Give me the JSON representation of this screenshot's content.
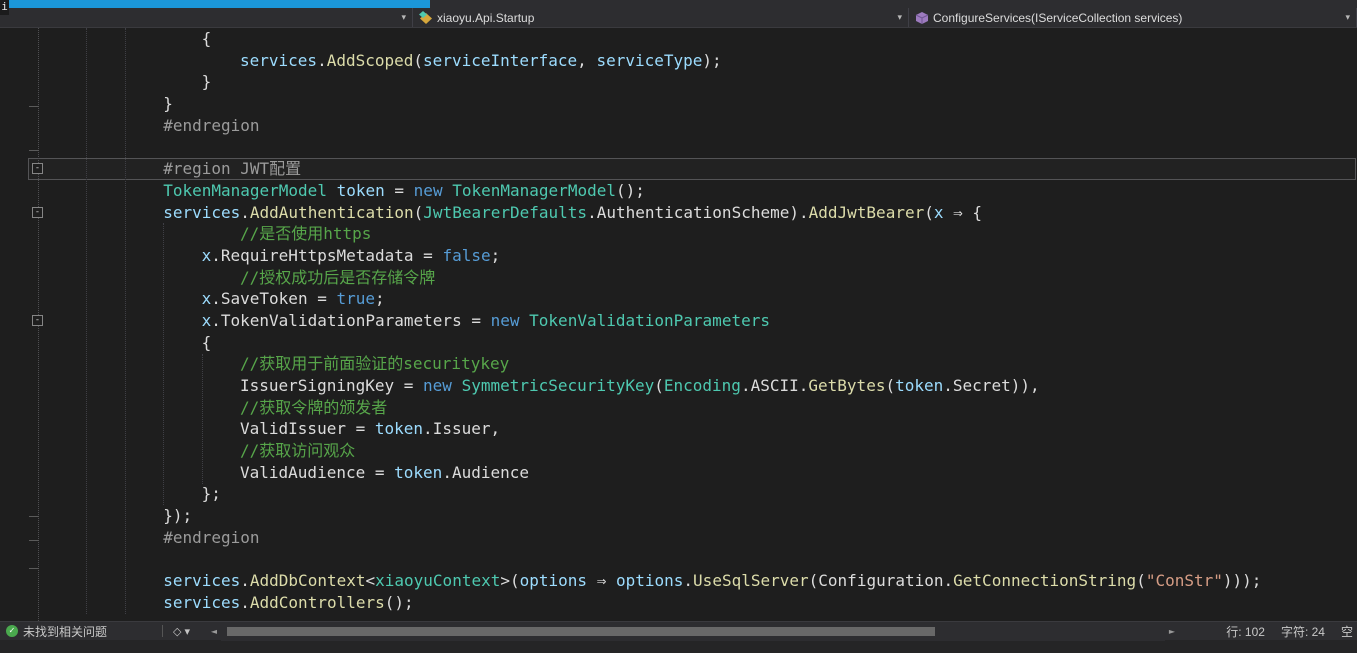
{
  "window": {
    "overlay_text": "i"
  },
  "nav": {
    "project_dropdown": {
      "value": ""
    },
    "type_dropdown": {
      "value": "xiaoyu.Api.Startup"
    },
    "member_dropdown": {
      "value": "ConfigureServices(IServiceCollection services)"
    }
  },
  "editor": {
    "current_line": 7,
    "fold_lines": [
      7,
      9,
      14
    ],
    "margin_ticks": [
      78,
      122,
      488,
      512,
      540
    ],
    "indent_guides": [
      {
        "col": 4,
        "from": 0,
        "to": 27
      },
      {
        "col": 8,
        "from": 0,
        "to": 27
      },
      {
        "col": 12,
        "from": 9,
        "to": 22
      },
      {
        "col": 16,
        "from": 15,
        "to": 21
      }
    ],
    "token_colors": {
      "p": "#dcdcdc",
      "kw": "#569cd6",
      "ty": "#4ec9b0",
      "lo": "#9cdcfe",
      "m": "#dcdcaa",
      "c": "#57a64a",
      "s": "#d69d85",
      "pp": "#9b9b9b"
    },
    "lines": [
      {
        "indent": 16,
        "tokens": [
          [
            "p",
            "{"
          ]
        ]
      },
      {
        "indent": 20,
        "tokens": [
          [
            "lo",
            "services"
          ],
          [
            "p",
            "."
          ],
          [
            "m",
            "AddScoped"
          ],
          [
            "p",
            "("
          ],
          [
            "lo",
            "serviceInterface"
          ],
          [
            "p",
            ", "
          ],
          [
            "lo",
            "serviceType"
          ],
          [
            "p",
            ");"
          ]
        ]
      },
      {
        "indent": 16,
        "tokens": [
          [
            "p",
            "}"
          ]
        ]
      },
      {
        "indent": 12,
        "tokens": [
          [
            "p",
            "}"
          ]
        ]
      },
      {
        "indent": 12,
        "tokens": [
          [
            "pp",
            "#endregion"
          ]
        ]
      },
      {
        "indent": 0,
        "tokens": []
      },
      {
        "indent": 12,
        "tokens": [
          [
            "pp",
            "#region JWT配置"
          ]
        ]
      },
      {
        "indent": 12,
        "tokens": [
          [
            "ty",
            "TokenManagerModel"
          ],
          [
            "p",
            " "
          ],
          [
            "lo",
            "token"
          ],
          [
            "p",
            " = "
          ],
          [
            "kw",
            "new"
          ],
          [
            "p",
            " "
          ],
          [
            "ty",
            "TokenManagerModel"
          ],
          [
            "p",
            "();"
          ]
        ]
      },
      {
        "indent": 12,
        "tokens": [
          [
            "lo",
            "services"
          ],
          [
            "p",
            "."
          ],
          [
            "m",
            "AddAuthentication"
          ],
          [
            "p",
            "("
          ],
          [
            "ty",
            "JwtBearerDefaults"
          ],
          [
            "p",
            "."
          ],
          [
            "p",
            "AuthenticationScheme"
          ],
          [
            "p",
            ")."
          ],
          [
            "m",
            "AddJwtBearer"
          ],
          [
            "p",
            "("
          ],
          [
            "lo",
            "x"
          ],
          [
            "p",
            " ⇒ {"
          ]
        ]
      },
      {
        "indent": 20,
        "tokens": [
          [
            "c",
            "//是否使用https"
          ]
        ]
      },
      {
        "indent": 16,
        "tokens": [
          [
            "lo",
            "x"
          ],
          [
            "p",
            "."
          ],
          [
            "p",
            "RequireHttpsMetadata"
          ],
          [
            "p",
            " = "
          ],
          [
            "kw",
            "false"
          ],
          [
            "p",
            ";"
          ]
        ]
      },
      {
        "indent": 20,
        "tokens": [
          [
            "c",
            "//授权成功后是否存储令牌"
          ]
        ]
      },
      {
        "indent": 16,
        "tokens": [
          [
            "lo",
            "x"
          ],
          [
            "p",
            "."
          ],
          [
            "p",
            "SaveToken"
          ],
          [
            "p",
            " = "
          ],
          [
            "kw",
            "true"
          ],
          [
            "p",
            ";"
          ]
        ]
      },
      {
        "indent": 16,
        "tokens": [
          [
            "lo",
            "x"
          ],
          [
            "p",
            "."
          ],
          [
            "p",
            "TokenValidationParameters"
          ],
          [
            "p",
            " = "
          ],
          [
            "kw",
            "new"
          ],
          [
            "p",
            " "
          ],
          [
            "ty",
            "TokenValidationParameters"
          ]
        ]
      },
      {
        "indent": 16,
        "tokens": [
          [
            "p",
            "{"
          ]
        ]
      },
      {
        "indent": 20,
        "tokens": [
          [
            "c",
            "//获取用于前面验证的securitykey"
          ]
        ]
      },
      {
        "indent": 20,
        "tokens": [
          [
            "p",
            "IssuerSigningKey"
          ],
          [
            "p",
            " = "
          ],
          [
            "kw",
            "new"
          ],
          [
            "p",
            " "
          ],
          [
            "ty",
            "SymmetricSecurityKey"
          ],
          [
            "p",
            "("
          ],
          [
            "ty",
            "Encoding"
          ],
          [
            "p",
            "."
          ],
          [
            "p",
            "ASCII"
          ],
          [
            "p",
            "."
          ],
          [
            "m",
            "GetBytes"
          ],
          [
            "p",
            "("
          ],
          [
            "lo",
            "token"
          ],
          [
            "p",
            "."
          ],
          [
            "p",
            "Secret"
          ],
          [
            "p",
            ")),"
          ]
        ]
      },
      {
        "indent": 20,
        "tokens": [
          [
            "c",
            "//获取令牌的颁发者"
          ]
        ]
      },
      {
        "indent": 20,
        "tokens": [
          [
            "p",
            "ValidIssuer"
          ],
          [
            "p",
            " = "
          ],
          [
            "lo",
            "token"
          ],
          [
            "p",
            "."
          ],
          [
            "p",
            "Issuer"
          ],
          [
            "p",
            ","
          ]
        ]
      },
      {
        "indent": 20,
        "tokens": [
          [
            "c",
            "//获取访问观众"
          ]
        ]
      },
      {
        "indent": 20,
        "tokens": [
          [
            "p",
            "ValidAudience"
          ],
          [
            "p",
            " = "
          ],
          [
            "lo",
            "token"
          ],
          [
            "p",
            "."
          ],
          [
            "p",
            "Audience"
          ]
        ]
      },
      {
        "indent": 16,
        "tokens": [
          [
            "p",
            "};"
          ]
        ]
      },
      {
        "indent": 12,
        "tokens": [
          [
            "p",
            "});"
          ]
        ]
      },
      {
        "indent": 12,
        "tokens": [
          [
            "pp",
            "#endregion"
          ]
        ]
      },
      {
        "indent": 0,
        "tokens": []
      },
      {
        "indent": 12,
        "tokens": [
          [
            "lo",
            "services"
          ],
          [
            "p",
            "."
          ],
          [
            "m",
            "AddDbContext"
          ],
          [
            "p",
            "<"
          ],
          [
            "ty",
            "xiaoyuContext"
          ],
          [
            "p",
            ">("
          ],
          [
            "lo",
            "options"
          ],
          [
            "p",
            " ⇒ "
          ],
          [
            "lo",
            "options"
          ],
          [
            "p",
            "."
          ],
          [
            "m",
            "UseSqlServer"
          ],
          [
            "p",
            "("
          ],
          [
            "p",
            "Configuration"
          ],
          [
            "p",
            "."
          ],
          [
            "m",
            "GetConnectionString"
          ],
          [
            "p",
            "("
          ],
          [
            "s",
            "\"ConStr\""
          ],
          [
            "p",
            ")));"
          ]
        ]
      },
      {
        "indent": 12,
        "tokens": [
          [
            "lo",
            "services"
          ],
          [
            "p",
            "."
          ],
          [
            "m",
            "AddControllers"
          ],
          [
            "p",
            "();"
          ]
        ]
      }
    ]
  },
  "bottom": {
    "issues_text": "未找到相关问题",
    "check_glyph": "✓",
    "fold_glyph": "-",
    "chevron_glyph": "▾",
    "cleanup_glyph": "◇",
    "left_arrow_glyph": "◄",
    "right_arrow_glyph": "►",
    "line_label": "行: 102",
    "char_label": "字符: 24",
    "space_label": "空"
  }
}
